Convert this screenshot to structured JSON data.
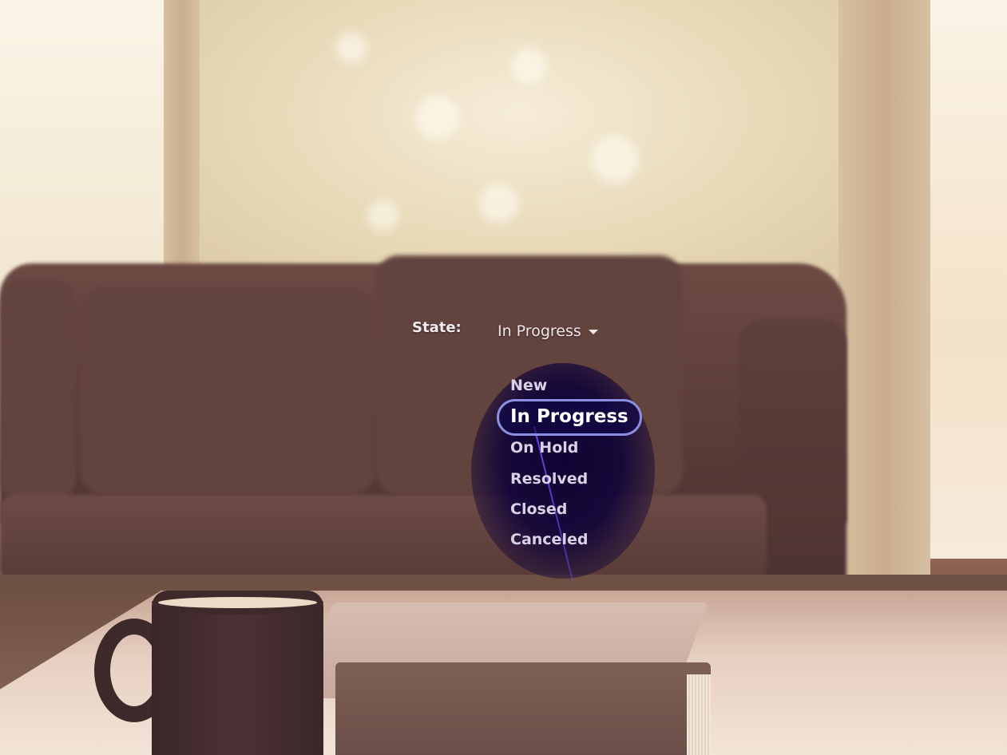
{
  "form": {
    "state_label": "State:",
    "state_value": "In Progress",
    "caret_icon": "caret-down-icon"
  },
  "dropdown": {
    "options": [
      "New",
      "In Progress",
      "On Hold",
      "Resolved",
      "Closed",
      "Canceled"
    ],
    "selected": "In Progress",
    "highlight_color": "#8a8fe2",
    "background_color": "#0c0232",
    "pointer_color": "#6e50ff"
  }
}
